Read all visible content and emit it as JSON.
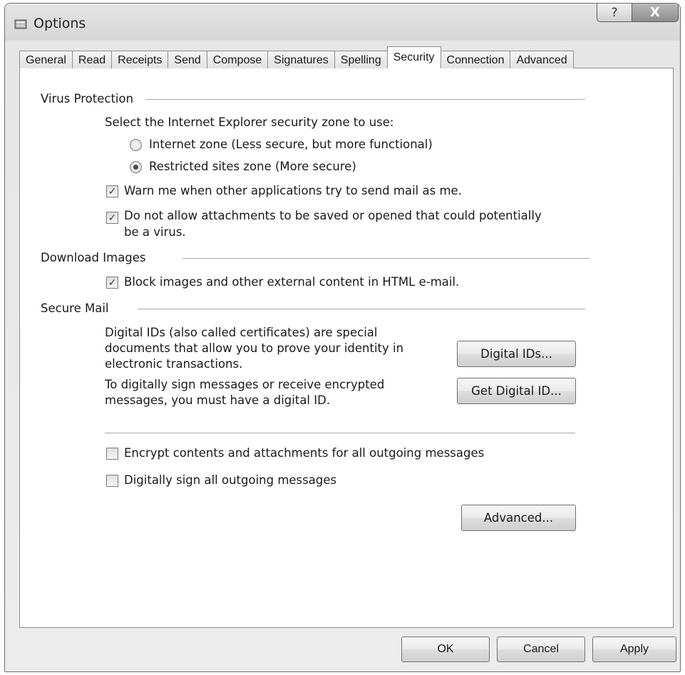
{
  "window": {
    "title": "Options",
    "help_label": "?",
    "close_label": "X"
  },
  "tabs": [
    "General",
    "Read",
    "Receipts",
    "Send",
    "Compose",
    "Signatures",
    "Spelling",
    "Security",
    "Connection",
    "Advanced"
  ],
  "active_tab": "Security",
  "virus_protection": {
    "label": "Virus Protection",
    "zone_prompt": "Select the Internet Explorer security zone to use:",
    "radio_internet": "Internet zone (Less secure, but more functional)",
    "radio_restricted": "Restricted sites zone (More secure)",
    "selected_zone": "Restricted sites zone (More secure)",
    "warn_label": "Warn me when other applications try to send mail as me.",
    "warn_checked": true,
    "attach_label_line1": "Do not allow attachments to be saved or opened that could potentially",
    "attach_label_line2": "be a virus.",
    "attach_checked": true
  },
  "download_images": {
    "label": "Download Images",
    "block_label": "Block images and other external content in HTML e-mail.",
    "block_checked": true
  },
  "secure_mail": {
    "label": "Secure Mail",
    "desc1_line1": "Digital IDs (also called certificates) are special",
    "desc1_line2": "documents that allow you to prove your identity in",
    "desc1_line3": "electronic transactions.",
    "desc2_line1": "To digitally sign messages or receive encrypted",
    "desc2_line2": "messages, you must have a digital ID.",
    "digital_ids_button": "Digital IDs...",
    "get_digital_id_button": "Get Digital ID...",
    "encrypt_label": "Encrypt contents and attachments for all outgoing messages",
    "encrypt_checked": false,
    "sign_label": "Digitally sign all outgoing messages",
    "sign_checked": false,
    "advanced_button": "Advanced..."
  },
  "footer": {
    "ok": "OK",
    "cancel": "Cancel",
    "apply": "Apply"
  }
}
